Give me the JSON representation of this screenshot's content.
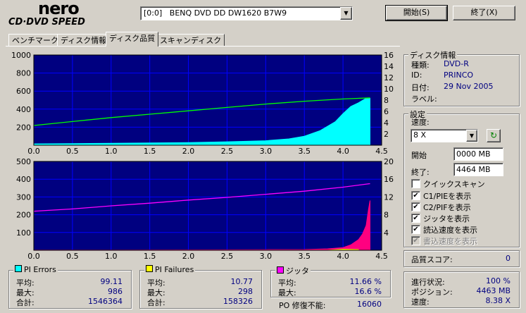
{
  "logo": {
    "line1": "nero",
    "line2": "CD·DVD SPEED"
  },
  "drive_selector": {
    "value": "[0:0]   BENQ DVD DD DW1620 B7W9"
  },
  "buttons": {
    "start": "開始(S)",
    "exit": "終了(X)"
  },
  "tabs": [
    "ベンチマーク",
    "ディスク情報",
    "ディスク品質",
    "スキャンディスク"
  ],
  "active_tab": 2,
  "disc_info": {
    "title": "ディスク情報",
    "rows": [
      {
        "label": "種類:",
        "value": "DVD-R"
      },
      {
        "label": "ID:",
        "value": "PRINCO"
      },
      {
        "label": "日付:",
        "value": "29 Nov 2005"
      },
      {
        "label": "ラベル:",
        "value": ""
      }
    ]
  },
  "settings": {
    "title": "設定",
    "speed_label": "速度:",
    "speed_value": "8 X",
    "start_label": "開始",
    "start_value": "0000 MB",
    "end_label": "終了:",
    "end_value": "4464 MB",
    "checkboxes": [
      {
        "label": "クイックスキャン",
        "checked": false,
        "disabled": false
      },
      {
        "label": "C1/PIEを表示",
        "checked": true,
        "disabled": false
      },
      {
        "label": "C2/PIFを表示",
        "checked": true,
        "disabled": false
      },
      {
        "label": "ジッタを表示",
        "checked": true,
        "disabled": false
      },
      {
        "label": "読込速度を表示",
        "checked": true,
        "disabled": false
      },
      {
        "label": "書込速度を表示",
        "checked": true,
        "disabled": true
      }
    ]
  },
  "quality_score": {
    "label": "品質スコア:",
    "value": "0"
  },
  "progress": {
    "rows": [
      {
        "label": "進行状況:",
        "value": "100 %"
      },
      {
        "label": "ポジション:",
        "value": "4463 MB"
      },
      {
        "label": "速度:",
        "value": "8.38 X"
      }
    ]
  },
  "pi_errors": {
    "title": "PI Errors",
    "color": "#00ffff",
    "rows": [
      {
        "label": "平均:",
        "value": "99.11"
      },
      {
        "label": "最大:",
        "value": "986"
      },
      {
        "label": "合計:",
        "value": "1546364"
      }
    ]
  },
  "pi_failures": {
    "title": "PI Failures",
    "color": "#ffff00",
    "rows": [
      {
        "label": "平均:",
        "value": "10.77"
      },
      {
        "label": "最大:",
        "value": "298"
      },
      {
        "label": "合計:",
        "value": "158326"
      }
    ]
  },
  "jitter": {
    "title": "ジッタ",
    "color": "#ff00ff",
    "rows": [
      {
        "label": "平均:",
        "value": "11.66 %"
      },
      {
        "label": "最大:",
        "value": "16.6 %"
      }
    ]
  },
  "po_fail": {
    "label": "PO 修復不能:",
    "value": "16060"
  },
  "chart_data": [
    {
      "type": "area",
      "name_note": "upper chart: PI errors (area) with read speed (line)",
      "x_ticks": [
        "0.0",
        "0.5",
        "1.0",
        "1.5",
        "2.0",
        "2.5",
        "3.0",
        "3.5",
        "4.0",
        "4.5"
      ],
      "xlim": [
        0,
        4.5
      ],
      "y_left_ticks": [
        "1000",
        "800",
        "600",
        "400",
        "200"
      ],
      "ylim_left": [
        0,
        1000
      ],
      "y_right_ticks": [
        "16",
        "14",
        "12",
        "10",
        "8",
        "6",
        "4",
        "2"
      ],
      "ylim_right": [
        0,
        16
      ],
      "grid": true,
      "background": "#000080",
      "series": [
        {
          "kind": "area",
          "color": "#00ffff",
          "x": [
            0,
            0.5,
            1.0,
            1.5,
            2.0,
            2.5,
            3.0,
            3.3,
            3.5,
            3.7,
            3.9,
            4.0,
            4.1,
            4.2,
            4.3,
            4.35
          ],
          "y": [
            15,
            18,
            22,
            25,
            30,
            38,
            50,
            70,
            100,
            160,
            260,
            350,
            430,
            470,
            520,
            520
          ]
        },
        {
          "kind": "line",
          "axis": "right",
          "color": "#00ff00",
          "x": [
            0,
            0.5,
            1.0,
            1.5,
            2.0,
            2.5,
            3.0,
            3.5,
            4.0,
            4.35
          ],
          "y": [
            3.5,
            4.2,
            4.9,
            5.5,
            6.1,
            6.7,
            7.3,
            7.8,
            8.2,
            8.4
          ]
        }
      ]
    },
    {
      "type": "area",
      "name_note": "lower chart: PI failures (area) with jitter (line)",
      "x_ticks": [
        "0.0",
        "0.5",
        "1.0",
        "1.5",
        "2.0",
        "2.5",
        "3.0",
        "3.5",
        "4.0",
        "4.5"
      ],
      "xlim": [
        0,
        4.5
      ],
      "y_left_ticks": [
        "500",
        "400",
        "300",
        "200",
        "100"
      ],
      "ylim_left": [
        0,
        500
      ],
      "y_right_ticks": [
        "20",
        "16",
        "12",
        "8",
        "4"
      ],
      "ylim_right": [
        0,
        20
      ],
      "grid": true,
      "background": "#000080",
      "series": [
        {
          "kind": "area",
          "color": "#ff0080",
          "x": [
            0,
            1.0,
            2.0,
            3.0,
            3.5,
            3.8,
            4.0,
            4.1,
            4.2,
            4.25,
            4.3,
            4.33,
            4.35
          ],
          "y": [
            1,
            1,
            2,
            3,
            4,
            8,
            15,
            30,
            60,
            90,
            140,
            230,
            280
          ]
        },
        {
          "kind": "area",
          "color": "#ffff00",
          "x": [
            3.8,
            3.9,
            4.0,
            4.1,
            4.2
          ],
          "y": [
            0,
            3,
            6,
            5,
            4
          ]
        },
        {
          "kind": "line",
          "axis": "right",
          "color": "#ff00ff",
          "x": [
            0,
            0.5,
            1.0,
            1.5,
            2.0,
            2.5,
            3.0,
            3.5,
            4.0,
            4.35
          ],
          "y": [
            8.8,
            9.3,
            10.0,
            10.6,
            11.3,
            11.9,
            12.6,
            13.3,
            14.2,
            15.0
          ]
        }
      ]
    }
  ]
}
